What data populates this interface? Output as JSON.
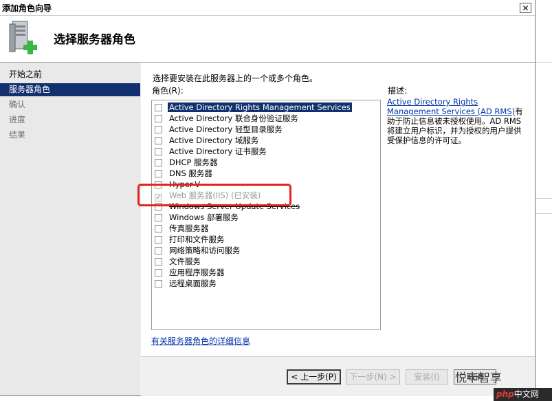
{
  "window": {
    "title": "添加角色向导",
    "close_glyph": "✕"
  },
  "header": {
    "title": "选择服务器角色",
    "icon": "server-add-icon"
  },
  "nav": [
    {
      "label": "开始之前",
      "state": "normal"
    },
    {
      "label": "服务器角色",
      "state": "selected"
    },
    {
      "label": "确认",
      "state": "disabled"
    },
    {
      "label": "进度",
      "state": "disabled"
    },
    {
      "label": "结果",
      "state": "disabled"
    }
  ],
  "main": {
    "prompt": "选择要安装在此服务器上的一个或多个角色。",
    "roles_label": "角色(R):",
    "roles": [
      {
        "label": "Active Directory Rights Management Services",
        "checked": false,
        "highlighted": true
      },
      {
        "label": "Active Directory 联合身份验证服务",
        "checked": false
      },
      {
        "label": "Active Directory 轻型目录服务",
        "checked": false
      },
      {
        "label": "Active Directory 域服务",
        "checked": false
      },
      {
        "label": "Active Directory 证书服务",
        "checked": false
      },
      {
        "label": "DHCP 服务器",
        "checked": false
      },
      {
        "label": "DNS 服务器",
        "checked": false
      },
      {
        "label": "Hyper-V",
        "checked": false,
        "obscured": true
      },
      {
        "label": "Web 服务器(IIS)  (已安装)",
        "checked": true,
        "disabled": true
      },
      {
        "label": "Windows Server Update Services",
        "checked": false,
        "obscured": true
      },
      {
        "label": "Windows 部署服务",
        "checked": false
      },
      {
        "label": "传真服务器",
        "checked": false
      },
      {
        "label": "打印和文件服务",
        "checked": false
      },
      {
        "label": "网络策略和访问服务",
        "checked": false
      },
      {
        "label": "文件服务",
        "checked": false
      },
      {
        "label": "应用程序服务器",
        "checked": false
      },
      {
        "label": "远程桌面服务",
        "checked": false
      }
    ],
    "more_link": "有关服务器角色的详细信息",
    "desc_title": "描述:",
    "desc_link": "Active Directory Rights Management Services (AD RMS)",
    "desc_text": "有助于防止信息被未授权使用。AD RMS 将建立用户标识，并为授权的用户提供受保护信息的许可证。"
  },
  "buttons": {
    "prev": "< 上一步(P)",
    "next": "下一步(N) >",
    "install": "安装(I)",
    "cancel": "取消"
  },
  "watermark": {
    "text": "悦卡智享",
    "site_a": "php",
    "site_b": "中文网"
  },
  "colors": {
    "accent": "#12306e",
    "annotation": "#e5221b",
    "link": "#0033aa"
  }
}
